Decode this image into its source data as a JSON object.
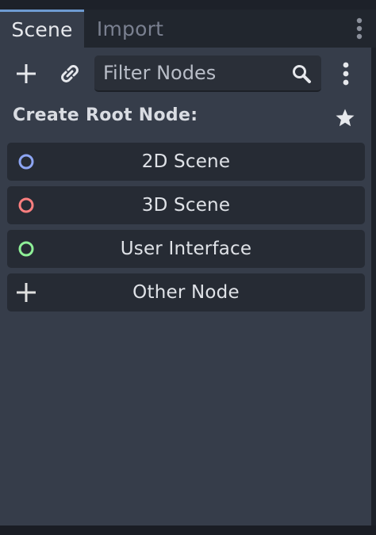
{
  "tabs": [
    {
      "label": "Scene",
      "active": true
    },
    {
      "label": "Import",
      "active": false
    }
  ],
  "toolbar": {
    "add_icon": "plus-icon",
    "instance_icon": "link-icon",
    "filter_placeholder": "Filter Nodes",
    "filter_value": "",
    "search_icon": "search-icon",
    "menu_icon": "vertical-ellipsis-icon"
  },
  "create_root": {
    "heading": "Create Root Node:",
    "favorite_icon": "star-icon",
    "options": [
      {
        "label": "2D Scene",
        "icon": "circle-outline-icon",
        "color": "#8da5f3"
      },
      {
        "label": "3D Scene",
        "icon": "circle-outline-icon",
        "color": "#fc7f7f"
      },
      {
        "label": "User Interface",
        "icon": "circle-outline-icon",
        "color": "#8eef97"
      },
      {
        "label": "Other Node",
        "icon": "plus-icon",
        "color": "#e0e0e0"
      }
    ]
  },
  "colors": {
    "panel_bg": "#363d4a",
    "tabbar_bg": "#21262e",
    "button_bg": "#262b34",
    "accent": "#6e9bd1"
  }
}
